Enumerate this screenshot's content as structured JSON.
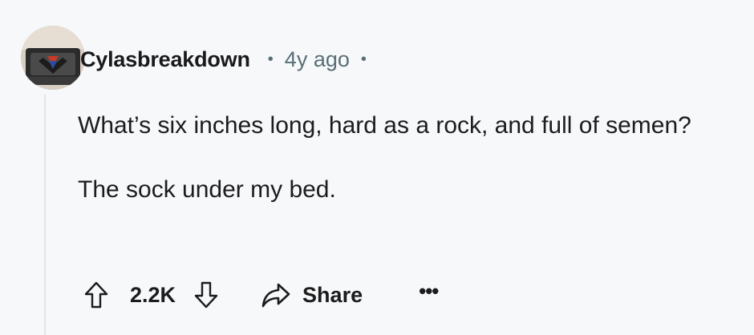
{
  "comment": {
    "author": "Cylasbreakdown",
    "separator": "•",
    "timestamp": "4y ago",
    "paragraphs": [
      "What’s six inches long, hard as a rock, and full of semen?",
      "The sock under my bed."
    ]
  },
  "actions": {
    "vote_count": "2.2K",
    "share_label": "Share",
    "more_label": "•••"
  },
  "icons": {
    "avatar": "user-avatar",
    "upvote": "upvote-arrow-icon",
    "downvote": "downvote-arrow-icon",
    "share": "share-arrow-icon",
    "more": "more-options-icon"
  },
  "colors": {
    "background": "#f7f8fa",
    "text": "#1c1c1c",
    "meta": "#576f76",
    "thread_line": "#e3e5e8"
  }
}
